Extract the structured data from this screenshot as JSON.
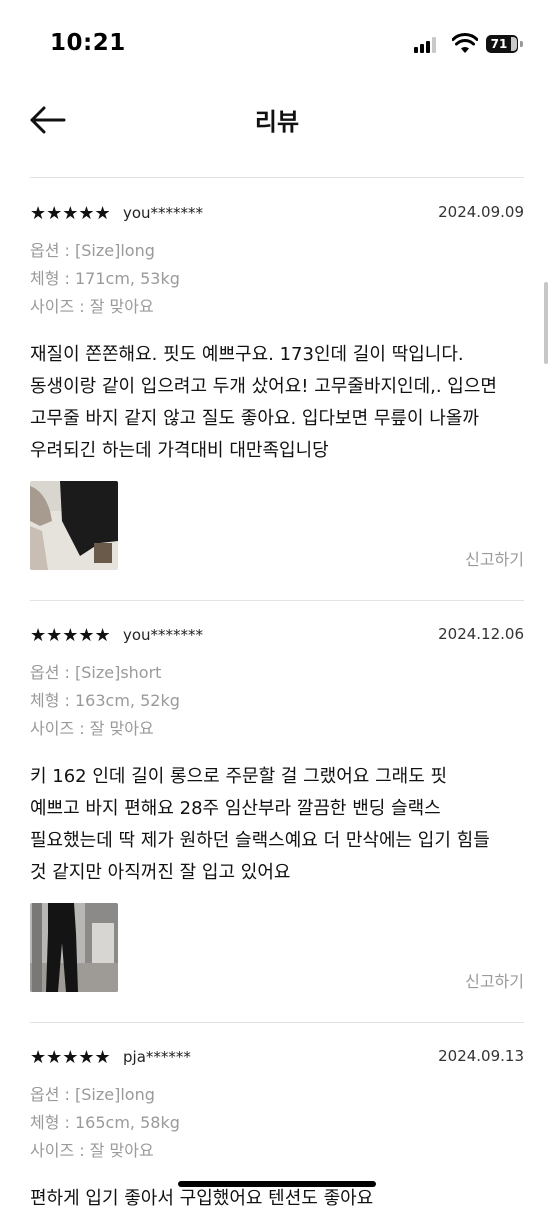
{
  "status_bar": {
    "time": "10:21",
    "battery": "71"
  },
  "header": {
    "title": "리뷰"
  },
  "labels": {
    "report": "신고하기"
  },
  "reviews": [
    {
      "stars": "★★★★★",
      "rating": 5,
      "author": "you*******",
      "date": "2024.09.09",
      "option": "옵션 : [Size]long",
      "body_type": "체형 : 171cm, 53kg",
      "size_fit": "사이즈 : 잘 맞아요",
      "lines": [
        "재질이 쫀쫀해요. 핏도 예쁘구요. 173인데 길이 딱입니다.",
        "동생이랑 같이 입으려고 두개 샀어요! 고무줄바지인데,. 입으면",
        "고무줄 바지 같지 않고 질도 좋아요. 입다보면 무릎이 나올까",
        "우려되긴 하는데 가격대비 대만족입니당"
      ]
    },
    {
      "stars": "★★★★★",
      "rating": 5,
      "author": "you*******",
      "date": "2024.12.06",
      "option": "옵션 : [Size]short",
      "body_type": "체형 : 163cm, 52kg",
      "size_fit": "사이즈 : 잘 맞아요",
      "lines": [
        "키 162 인데 길이 롱으로 주문할 걸 그랬어요 그래도 핏",
        "예쁘고 바지 편해요 28주 임산부라 깔끔한 밴딩 슬랙스",
        "필요했는데 딱 제가 원하던 슬랙스예요 더 만삭에는 입기 힘들",
        "것 같지만 아직꺼진 잘 입고 있어요"
      ]
    },
    {
      "stars": "★★★★★",
      "rating": 5,
      "author": "pja******",
      "date": "2024.09.13",
      "option": "옵션 : [Size]long",
      "body_type": "체형 : 165cm, 58kg",
      "size_fit": "사이즈 : 잘 맞아요",
      "lines": [
        "편하게 입기 좋아서 구입했어요 텐션도 좋아요"
      ]
    }
  ]
}
